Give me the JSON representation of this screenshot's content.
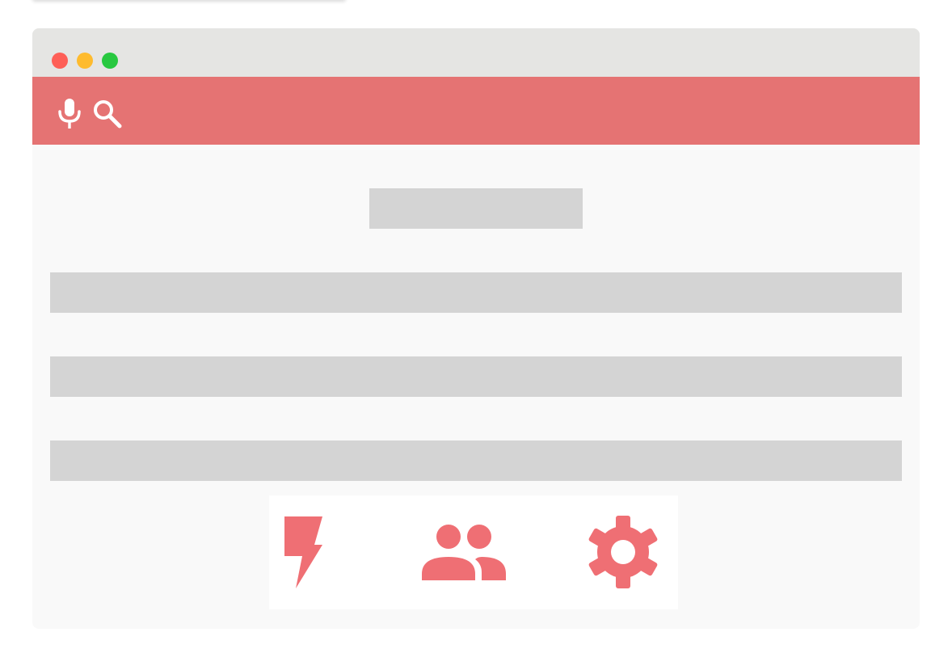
{
  "window": {
    "controls": [
      "close",
      "minimize",
      "maximize"
    ]
  },
  "toolbar": {
    "accent_color": "#e57373",
    "icons": [
      "mic-icon",
      "search-icon"
    ]
  },
  "content": {
    "placeholders": [
      "title",
      "row",
      "row",
      "row"
    ]
  },
  "actions": {
    "icon_color": "#ef6f74",
    "icons": [
      "flash-icon",
      "users-icon",
      "settings-icon"
    ]
  }
}
